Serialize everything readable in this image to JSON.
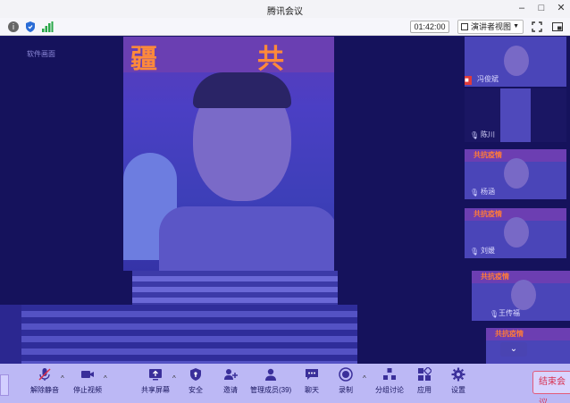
{
  "window": {
    "title": "腾讯会议"
  },
  "topbar": {
    "timer": "01:42:00",
    "view_label": "演讲者视图"
  },
  "stage": {
    "share_label": "软件画面"
  },
  "main_video": {
    "banner_left": "疆",
    "banner_right": "共"
  },
  "thumbnails": [
    {
      "name": "冯俊斌",
      "banner": ""
    },
    {
      "name": "陈川",
      "banner": ""
    },
    {
      "name": "杨涵",
      "banner": "共抗疫情"
    },
    {
      "name": "刘媛",
      "banner": "共抗疫情"
    },
    {
      "name": "王传福",
      "banner": "共抗疫情"
    },
    {
      "name": "",
      "banner": "共抗疫情"
    }
  ],
  "toolbar": {
    "unmute": "解除静音",
    "stop_video": "停止视频",
    "share_screen": "共享屏幕",
    "security": "安全",
    "invite": "邀请",
    "participants": "管理成员(39)",
    "chat": "聊天",
    "record": "录制",
    "breakout": "分组讨论",
    "apps": "应用",
    "settings": "设置",
    "end_meeting": "结束会议"
  }
}
